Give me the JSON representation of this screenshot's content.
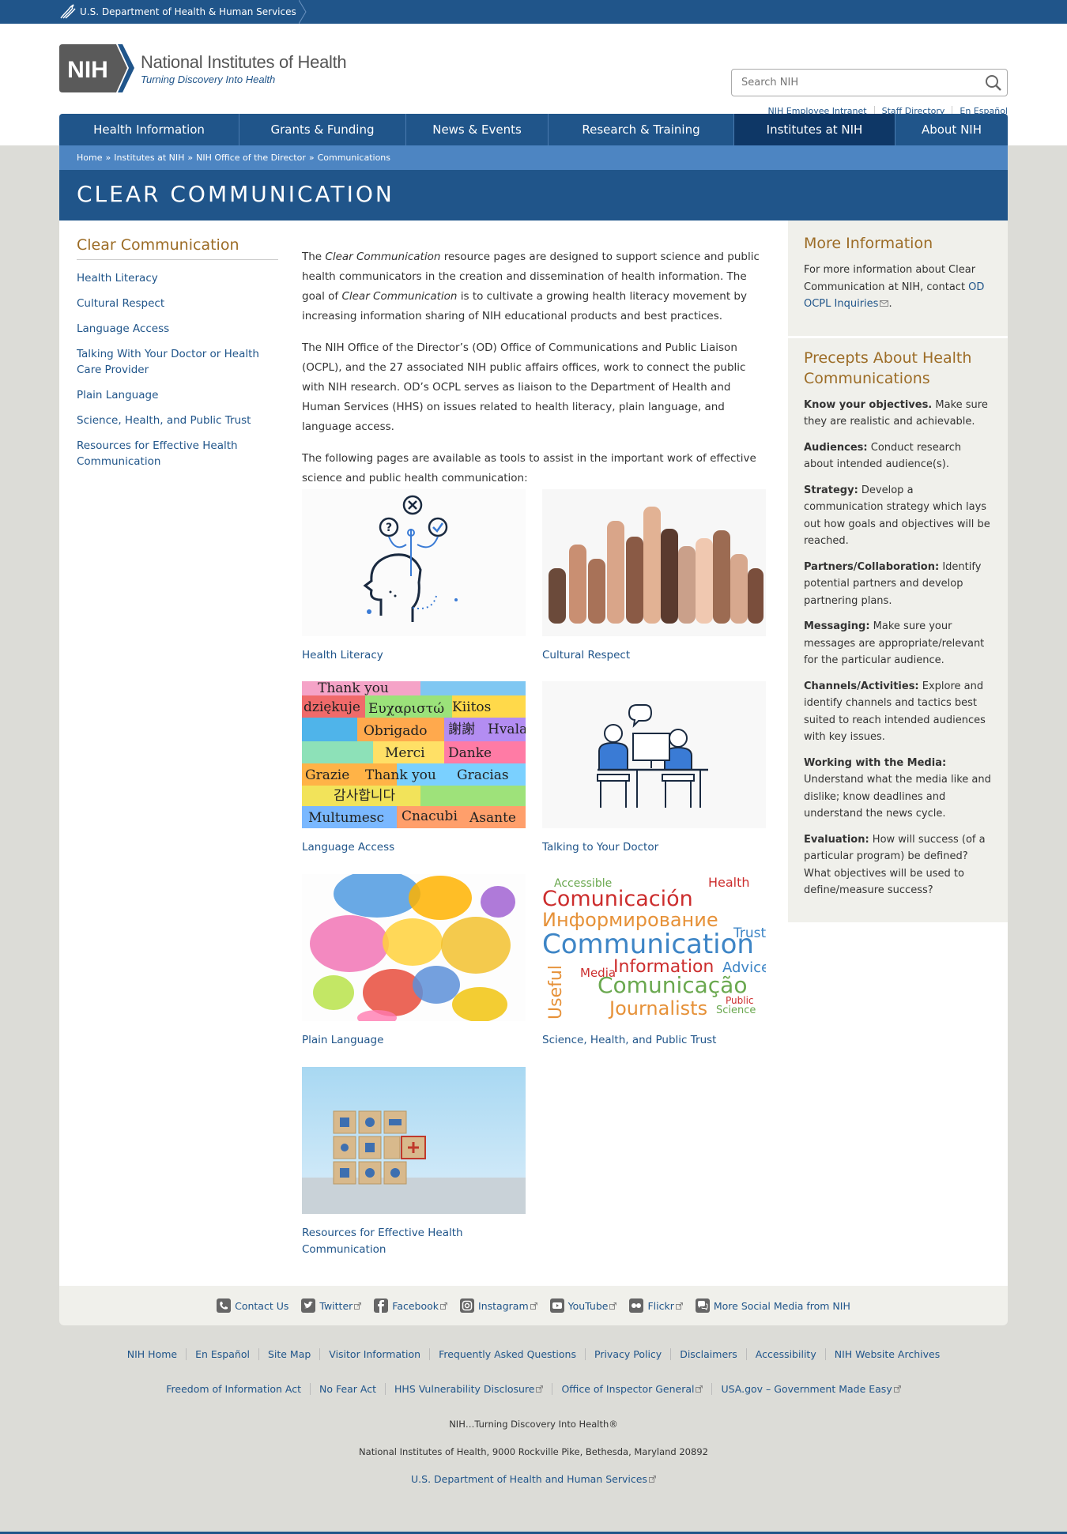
{
  "hhs": {
    "label": "U.S. Department of Health & Human Services"
  },
  "logo": {
    "abbr": "NIH",
    "title": "National Institutes of Health",
    "tagline": "Turning Discovery Into Health"
  },
  "search": {
    "placeholder": "Search NIH"
  },
  "utility_links": [
    "NIH Employee Intranet",
    "Staff Directory",
    "En Español"
  ],
  "nav": [
    {
      "label": "Health Information"
    },
    {
      "label": "Grants & Funding"
    },
    {
      "label": "News & Events"
    },
    {
      "label": "Research & Training"
    },
    {
      "label": "Institutes at NIH",
      "active": true
    },
    {
      "label": "About NIH"
    }
  ],
  "breadcrumb": [
    "Home",
    "Institutes at NIH",
    "NIH Office of the Director",
    "Communications"
  ],
  "page_title": "CLEAR COMMUNICATION",
  "left_nav": {
    "title": "Clear Communication",
    "items": [
      "Health Literacy",
      "Cultural Respect",
      "Language Access",
      "Talking With Your Doctor or Health Care Provider",
      "Plain Language",
      "Science, Health, and Public Trust",
      "Resources for Effective Health Communication"
    ]
  },
  "intro": {
    "p1_a": "The ",
    "p1_em": "Clear Communication",
    "p1_b": " resource pages are designed to support science and public health communicators in the creation and dissemination of health information. The goal of ",
    "p1_em2": "Clear Communication",
    "p1_c": " is to cultivate a growing health literacy movement by increasing information sharing of NIH educational products and best practices.",
    "p2": "The NIH Office of the Director’s (OD) Office of Communications and Public Liaison (OCPL), and the 27 associated NIH public affairs offices, work to connect the public with NIH research. OD’s OCPL serves as liaison to the Department of Health and Human Services (HHS) on issues related to health literacy, plain language, and language access.",
    "p3": "The following pages are available as tools to assist in the important work of effective science and public health communication:"
  },
  "tiles": [
    "Health Literacy",
    "Cultural Respect",
    "Language Access",
    "Talking to Your Doctor",
    "Plain Language",
    "Science, Health, and Public Trust",
    "Resources for Effective Health Communication"
  ],
  "language_words": [
    "Thank you",
    "Kiitos",
    "dziękuje",
    "Ευχαριστώ",
    "謝謝",
    "Hvala",
    "Obrigado",
    "Merci",
    "Danke",
    "Grazie",
    "Thank you",
    "Gracias",
    "감사합니다",
    "Multumesc",
    "Cnacubi",
    "Asante"
  ],
  "wordcloud_words": [
    "Accessible",
    "Health",
    "Comunicación",
    "Информирование",
    "Communication",
    "Information",
    "Advice",
    "Useful",
    "Comunicação",
    "Journalists",
    "Science",
    "Trust",
    "Media",
    "Public"
  ],
  "more_info": {
    "title": "More Information",
    "text": "For more information about Clear Communication at NIH, contact ",
    "link": "OD OCPL Inquiries",
    "end": "."
  },
  "precepts": {
    "title": "Precepts About Health Communications",
    "items": [
      {
        "term": "Know your objectives.",
        "text": " Make sure they are realistic and achievable."
      },
      {
        "term": "Audiences:",
        "text": " Conduct research about intended audience(s)."
      },
      {
        "term": "Strategy:",
        "text": " Develop a communication strategy which lays out how goals and objectives will be reached."
      },
      {
        "term": "Partners/Collaboration:",
        "text": " Identify potential partners and develop partnering plans."
      },
      {
        "term": "Messaging:",
        "text": " Make sure your messages are appropriate/relevant for the particular audience."
      },
      {
        "term": "Channels/Activities:",
        "text": " Explore and identify channels and tactics best suited to reach intended audiences with key issues."
      },
      {
        "term": "Working with the Media:",
        "text": " Understand what the media like and dislike; know deadlines and understand the news cycle."
      },
      {
        "term": "Evaluation:",
        "text": " How will success (of a particular program) be defined? What objectives will be used to define/measure success?"
      }
    ]
  },
  "social": [
    "Contact Us",
    "Twitter",
    "Facebook",
    "Instagram",
    "YouTube",
    "Flickr",
    "More Social Media from NIH"
  ],
  "footer_row1": [
    "NIH Home",
    "En Español",
    "Site Map",
    "Visitor Information",
    "Frequently Asked Questions",
    "Privacy Policy",
    "Disclaimers",
    "Accessibility",
    "NIH Website Archives"
  ],
  "footer_row2": [
    "Freedom of Information Act",
    "No Fear Act",
    "HHS Vulnerability Disclosure",
    "Office of Inspector General",
    "USA.gov – Government Made Easy"
  ],
  "footer_tagline": "NIH…Turning Discovery Into Health®",
  "footer_address": "National Institutes of Health, 9000 Rockville Pike, Bethesda, Maryland 20892",
  "footer_hhs": "U.S. Department of Health and Human Services",
  "colors": {
    "brand_blue": "#20558a",
    "dark_blue": "#0e3766",
    "gold": "#9c6c26",
    "sidebar_bg": "#f0f0eb",
    "page_bg": "#dcdcd7"
  }
}
